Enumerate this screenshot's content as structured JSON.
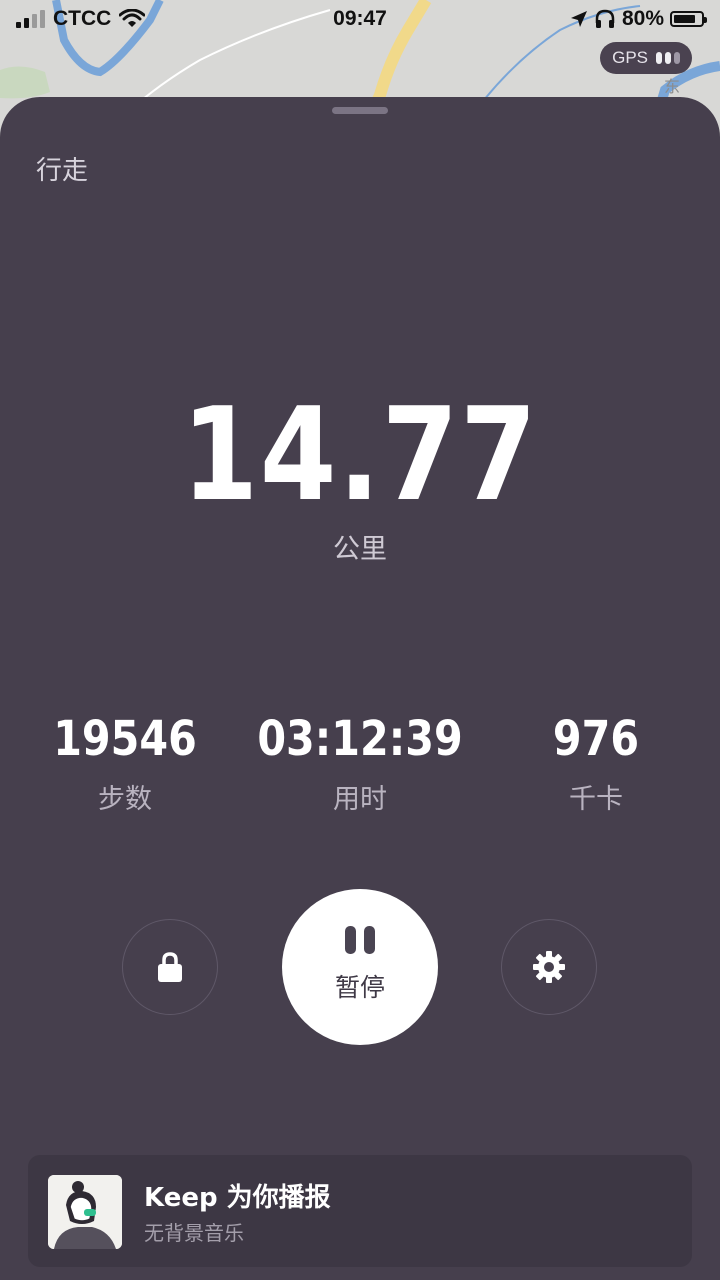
{
  "status_bar": {
    "carrier": "CTCC",
    "time": "09:47",
    "battery": "80%",
    "battery_level": 0.8,
    "icons": [
      "signal-icon",
      "wifi-icon",
      "location-arrow-icon",
      "headphones-icon",
      "battery-icon"
    ]
  },
  "map": {
    "label": "东"
  },
  "gps": {
    "label": "GPS",
    "strength_bars": 3,
    "strength_active": 2
  },
  "workout": {
    "mode": "行走",
    "distance": "14.77",
    "distance_unit": "公里"
  },
  "stats": [
    {
      "value": "19546",
      "label": "步数"
    },
    {
      "value": "03:12:39",
      "label": "用时"
    },
    {
      "value": "976",
      "label": "千卡"
    }
  ],
  "controls": {
    "pause_label": "暂停",
    "lock_icon": "lock-icon",
    "settings_icon": "gear-icon",
    "pause_icon": "pause-icon"
  },
  "banner": {
    "title": "Keep 为你播报",
    "subtitle": "无背景音乐"
  },
  "colors": {
    "sheet": "#463f4d",
    "banner": "#3d3744",
    "primary_text": "#ffffff",
    "secondary_text": "#b9b3c0"
  }
}
